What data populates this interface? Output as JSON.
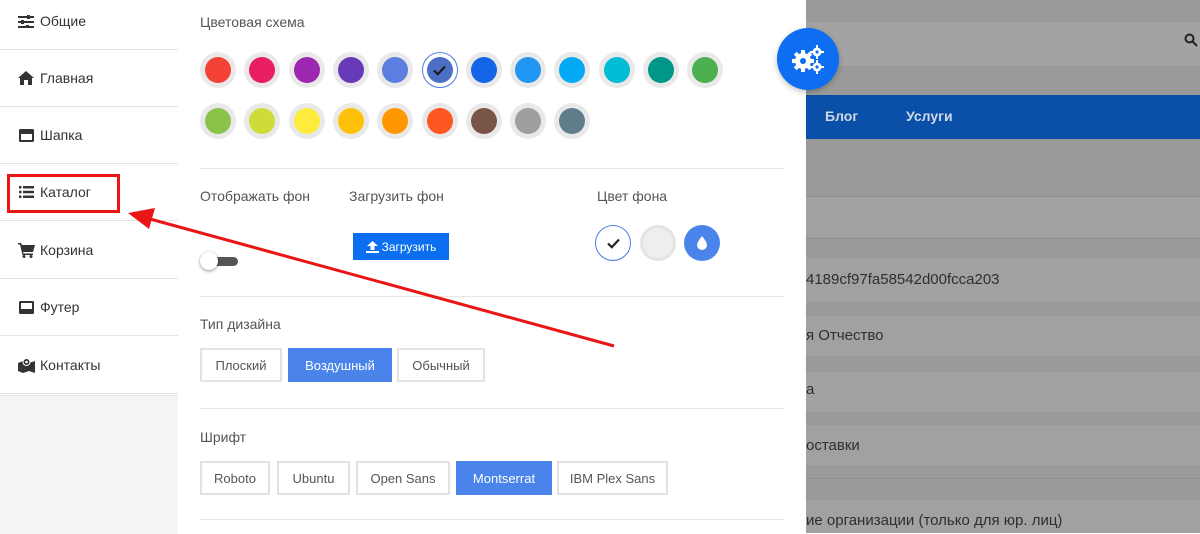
{
  "sidebar": {
    "items": [
      {
        "label": "Общие",
        "icon": "sliders-icon"
      },
      {
        "label": "Главная",
        "icon": "home-icon"
      },
      {
        "label": "Шапка",
        "icon": "header-icon"
      },
      {
        "label": "Каталог",
        "icon": "list-icon"
      },
      {
        "label": "Корзина",
        "icon": "cart-icon"
      },
      {
        "label": "Футер",
        "icon": "footer-icon"
      },
      {
        "label": "Контакты",
        "icon": "map-icon"
      }
    ]
  },
  "settings": {
    "color_scheme": {
      "title": "Цветовая схема",
      "selected_index": 5,
      "colors": [
        "#f44336",
        "#e91e63",
        "#9c27b0",
        "#673ab7",
        "#5b7ee0",
        "#4a6fc4",
        "#1565e8",
        "#2196f3",
        "#03a9f4",
        "#00bcd4",
        "#009688",
        "#4caf50",
        "#8bc34a",
        "#cddc39",
        "#ffeb3b",
        "#ffc107",
        "#ff9800",
        "#ff5722",
        "#795548",
        "#9e9e9e",
        "#607d8b"
      ]
    },
    "show_background": {
      "label": "Отображать фон",
      "enabled": false
    },
    "upload_background": {
      "title": "Загрузить фон",
      "button_label": "Загрузить"
    },
    "background_color": {
      "title": "Цвет фона",
      "options": [
        {
          "color": "#ffffff",
          "icon": "check-icon"
        },
        {
          "color": "#eeeeee",
          "icon": ""
        },
        {
          "color": "#4a83ea",
          "icon": "drop-icon"
        }
      ]
    },
    "design_type": {
      "title": "Тип дизайна",
      "options": [
        "Плоский",
        "Воздушный",
        "Обычный"
      ],
      "active": "Воздушный"
    },
    "font": {
      "title": "Шрифт",
      "options": [
        "Roboto",
        "Ubuntu",
        "Open Sans",
        "Montserrat",
        "IBM Plex Sans"
      ],
      "active": "Montserrat"
    }
  },
  "background_page": {
    "nav": [
      "Блог",
      "Услуги"
    ],
    "texts": [
      "4189cf97fa58542d00fcca203",
      "я Отчество",
      "а",
      "оставки",
      "ие организации (только для юр. лиц)"
    ]
  },
  "colors": {
    "accent": "#0d6ef2",
    "annotation": "#ea1515"
  }
}
